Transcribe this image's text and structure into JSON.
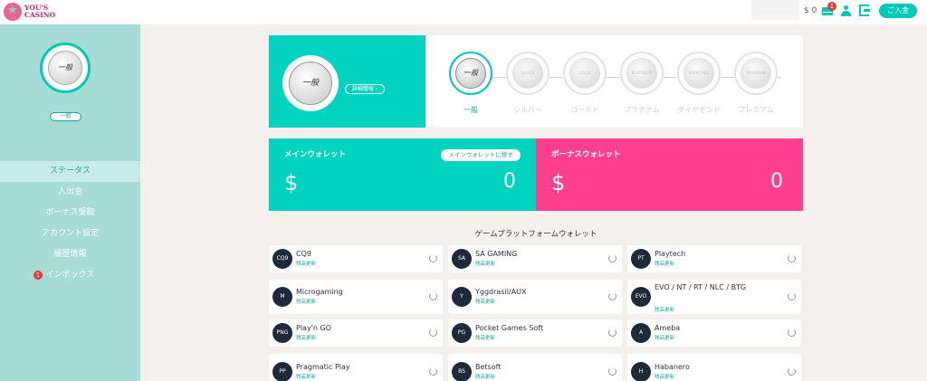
{
  "header": {
    "logo_text": "YOU'S CASINO",
    "balance": "$ 0",
    "mail_badge": "1",
    "deposit_label": "ご入金"
  },
  "sidebar": {
    "avatar_rank": "一般",
    "rank_label": "一般",
    "items": [
      {
        "label": "ステータス",
        "active": true
      },
      {
        "label": "入出金"
      },
      {
        "label": "ボーナス受取"
      },
      {
        "label": "アカウント設定"
      },
      {
        "label": "履歴情報"
      },
      {
        "label": "インボックス",
        "badge": "1"
      }
    ]
  },
  "rank": {
    "current": "一般",
    "detail_label": "詳細情報",
    "tiers": [
      {
        "label": "一般",
        "medal": "一般"
      },
      {
        "label": "シルバー",
        "medal": "SILVER"
      },
      {
        "label": "ゴールド",
        "medal": "GOLD"
      },
      {
        "label": "プラチナム",
        "medal": "PLATINUM"
      },
      {
        "label": "ダイヤモンド",
        "medal": "DIAMOND"
      },
      {
        "label": "プレミアム",
        "medal": "PREMIUM"
      }
    ]
  },
  "wallets": {
    "main": {
      "title": "メインウォレット",
      "move_label": "メインウォレットに移す",
      "currency": "$",
      "amount": "0"
    },
    "bonus": {
      "title": "ボーナスウォレット",
      "currency": "$",
      "amount": "0"
    }
  },
  "platforms": {
    "title": "ゲームプラットフォームウォレット",
    "refresh_label": "残高更新",
    "items": [
      {
        "name": "CQ9",
        "icon": "CQ9"
      },
      {
        "name": "SA GAMING",
        "icon": "SA"
      },
      {
        "name": "Playtech",
        "icon": "PT"
      },
      {
        "name": "Microgaming",
        "icon": "M"
      },
      {
        "name": "Yggdrasil/AUX",
        "icon": "Y"
      },
      {
        "name": "EVO / NT / RT / NLC / BTG",
        "icon": "EVO"
      },
      {
        "name": "Play'n GO",
        "icon": "PNG"
      },
      {
        "name": "Pocket Games Soft",
        "icon": "PG"
      },
      {
        "name": "Ameba",
        "icon": "A"
      },
      {
        "name": "Pragmatic Play",
        "icon": "PP"
      },
      {
        "name": "Betsoft",
        "icon": "BS"
      },
      {
        "name": "Habanero",
        "icon": "H"
      }
    ]
  }
}
